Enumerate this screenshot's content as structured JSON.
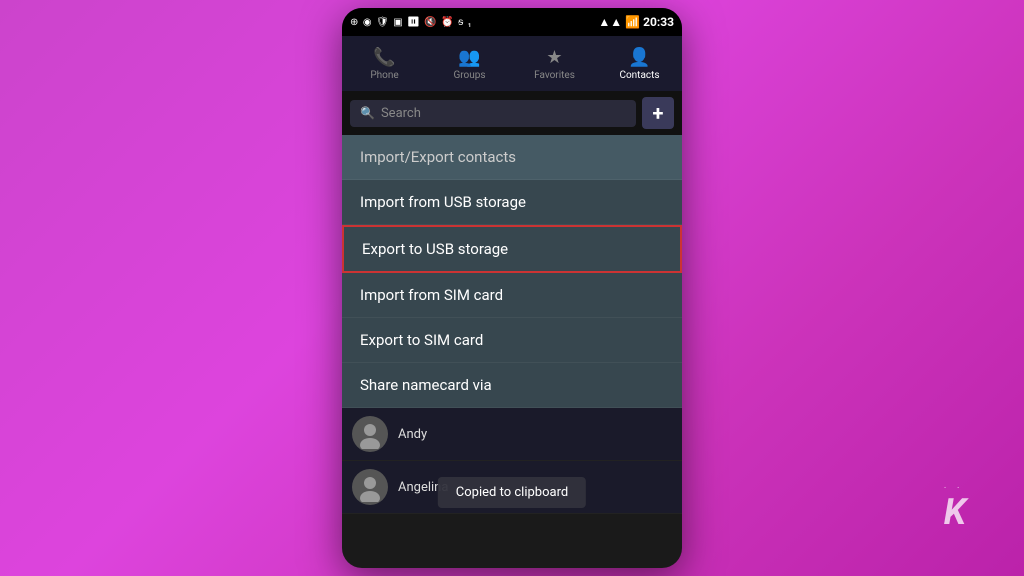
{
  "background": {
    "gradient_start": "#cc44cc",
    "gradient_end": "#bb22aa"
  },
  "status_bar": {
    "time": "20:33",
    "icons_left": [
      "⊕",
      "◉",
      "🛡",
      "▣",
      "⏸",
      "🔇",
      "⏰",
      "5",
      "📶",
      "📶"
    ],
    "signal": "▲▲▲▲"
  },
  "nav_tabs": [
    {
      "id": "phone",
      "label": "Phone",
      "icon": "📞",
      "active": false
    },
    {
      "id": "groups",
      "label": "Groups",
      "icon": "👥",
      "active": false
    },
    {
      "id": "favorites",
      "label": "Favorites",
      "icon": "★",
      "active": false
    },
    {
      "id": "contacts",
      "label": "Contacts",
      "icon": "👤",
      "active": true
    }
  ],
  "search": {
    "placeholder": "Search",
    "plus_label": "+"
  },
  "menu": {
    "title": "Import/Export contacts",
    "items": [
      {
        "id": "import-usb",
        "label": "Import from USB storage",
        "selected": false
      },
      {
        "id": "export-usb",
        "label": "Export to USB storage",
        "selected": true
      },
      {
        "id": "import-sim",
        "label": "Import from SIM card",
        "selected": false
      },
      {
        "id": "export-sim",
        "label": "Export to SIM card",
        "selected": false
      },
      {
        "id": "share-namecard",
        "label": "Share namecard via",
        "selected": false
      }
    ]
  },
  "contacts": [
    {
      "name": "Andy"
    },
    {
      "name": "Angelina"
    }
  ],
  "toast": {
    "message": "Copied to clipboard"
  },
  "branding": {
    "logo": "K",
    "dots": "·· "
  }
}
